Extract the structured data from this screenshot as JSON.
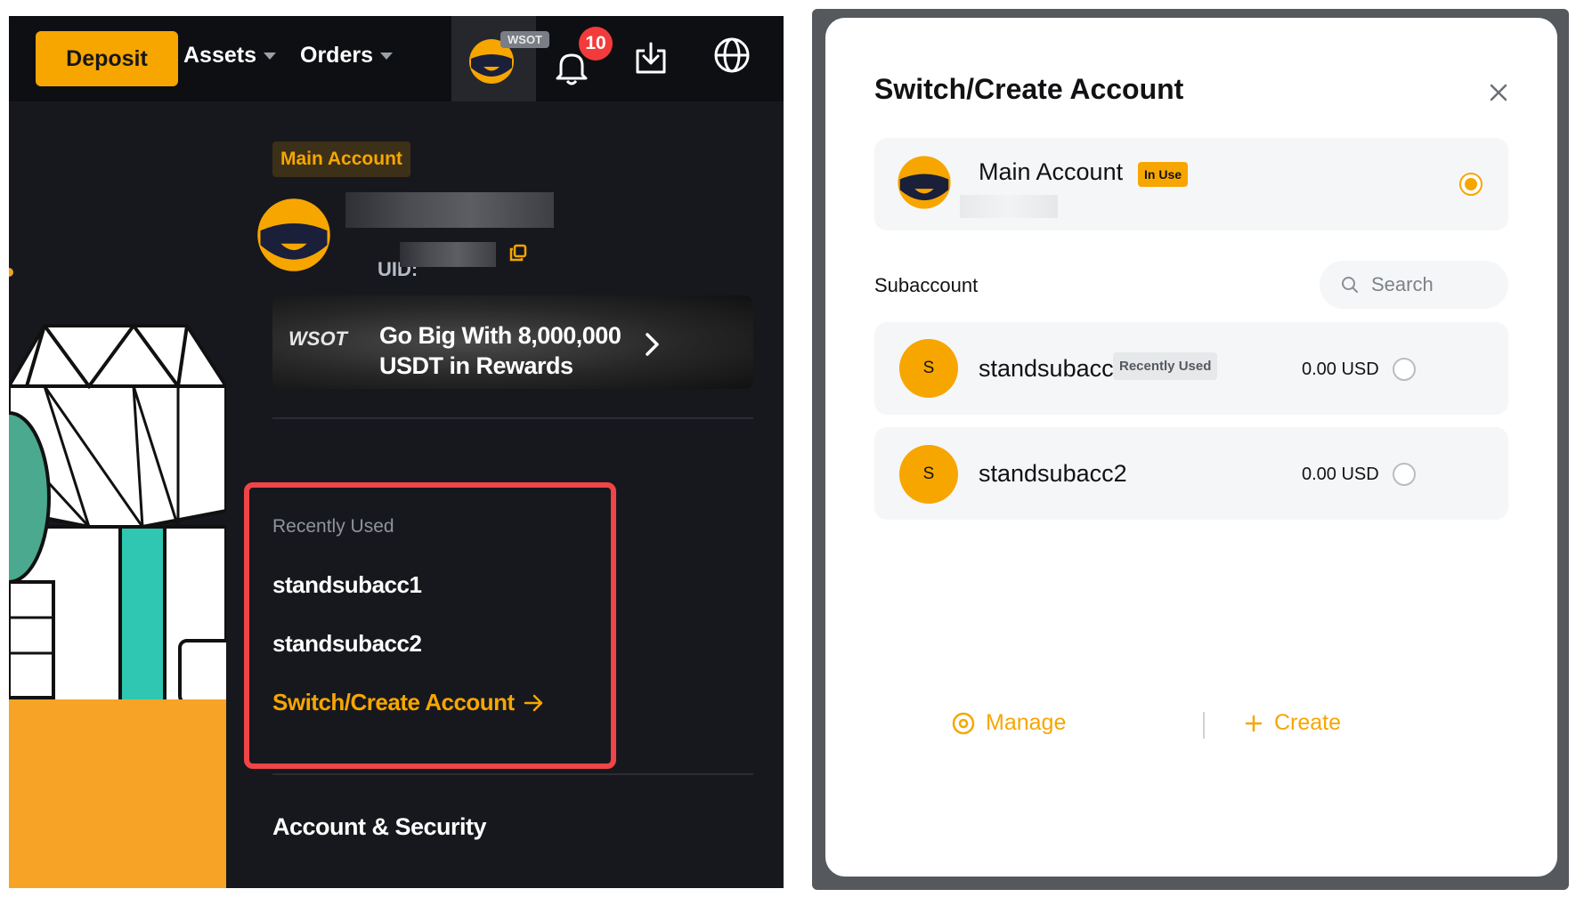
{
  "topbar": {
    "deposit_label": "Deposit",
    "assets_label": "Assets",
    "orders_label": "Orders",
    "avatar_tag": "WSOT",
    "notification_count": "10",
    "icons": [
      "bell-icon",
      "download-icon",
      "globe-icon"
    ]
  },
  "dropdown": {
    "account_tag": "Main Account",
    "uid_label": "UID:",
    "banner": {
      "logo": "WSOT",
      "line1": "Go Big With 8,000,000",
      "line2": "USDT in Rewards"
    },
    "recently_used_label": "Recently Used",
    "recent_accounts": [
      "standsubacc1",
      "standsubacc2"
    ],
    "switch_create_label": "Switch/Create Account",
    "account_security_label": "Account & Security"
  },
  "modal": {
    "title": "Switch/Create Account",
    "main_account": {
      "name": "Main Account",
      "tag": "In Use",
      "selected": true
    },
    "subaccount_label": "Subaccount",
    "search_placeholder": "Search",
    "subaccounts": [
      {
        "avatar_letter": "S",
        "name": "standsubacc1",
        "tag": "Recently Used",
        "balance": "0.00 USD",
        "selected": false
      },
      {
        "avatar_letter": "S",
        "name": "standsubacc2",
        "tag": "",
        "balance": "0.00 USD",
        "selected": false
      }
    ],
    "manage_label": "Manage",
    "create_label": "Create"
  },
  "colors": {
    "accent": "#f7a600",
    "dark_bg": "#17181e",
    "highlight_red": "#ef4546",
    "illustration_teal": "#2fc6b2",
    "illustration_orange": "#f7a325"
  }
}
